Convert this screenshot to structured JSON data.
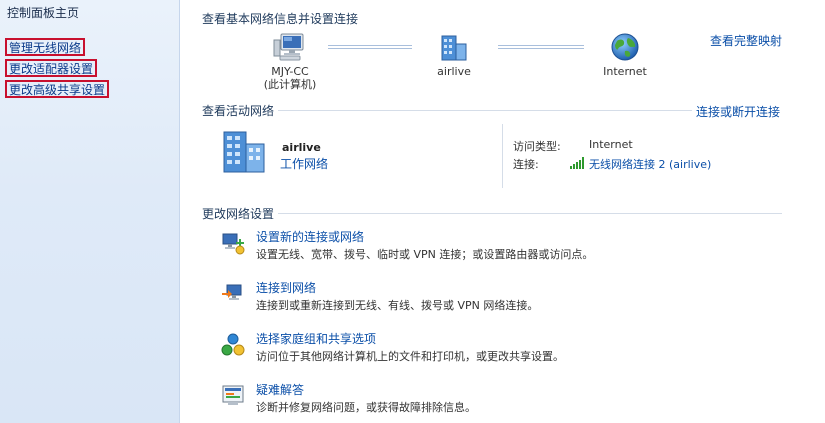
{
  "nav": {
    "home": "控制面板主页",
    "links": [
      "管理无线网络",
      "更改适配器设置",
      "更改高级共享设置"
    ]
  },
  "main": {
    "title": "查看基本网络信息并设置连接",
    "map_link": "查看完整映射",
    "map": {
      "computer": [
        "MJY-CC",
        "(此计算机)"
      ],
      "network": "airlive",
      "internet": "Internet"
    },
    "active": {
      "title": "查看活动网络",
      "connect_link": "连接或断开连接",
      "network_name": "airlive",
      "network_type": "工作网络",
      "access_label": "访问类型:",
      "access_value": "Internet",
      "connection_label": "连接:",
      "connection_value": "无线网络连接 2 (airlive)"
    },
    "change": {
      "title": "更改网络设置",
      "tasks": [
        {
          "link": "设置新的连接或网络",
          "desc": "设置无线、宽带、拨号、临时或 VPN 连接；或设置路由器或访问点。"
        },
        {
          "link": "连接到网络",
          "desc": "连接到或重新连接到无线、有线、拨号或 VPN 网络连接。"
        },
        {
          "link": "选择家庭组和共享选项",
          "desc": "访问位于其他网络计算机上的文件和打印机，或更改共享设置。"
        },
        {
          "link": "疑难解答",
          "desc": "诊断并修复网络问题，或获得故障排除信息。"
        }
      ]
    }
  },
  "colors": {
    "link": "#0b4fa8",
    "highlight_border": "#c8102e",
    "nav_bg": "#dfeaf8"
  },
  "icons": {
    "computer": "computer-icon",
    "network": "network-building-icon",
    "internet": "globe-icon",
    "signal": "wifi-signal-icon"
  }
}
